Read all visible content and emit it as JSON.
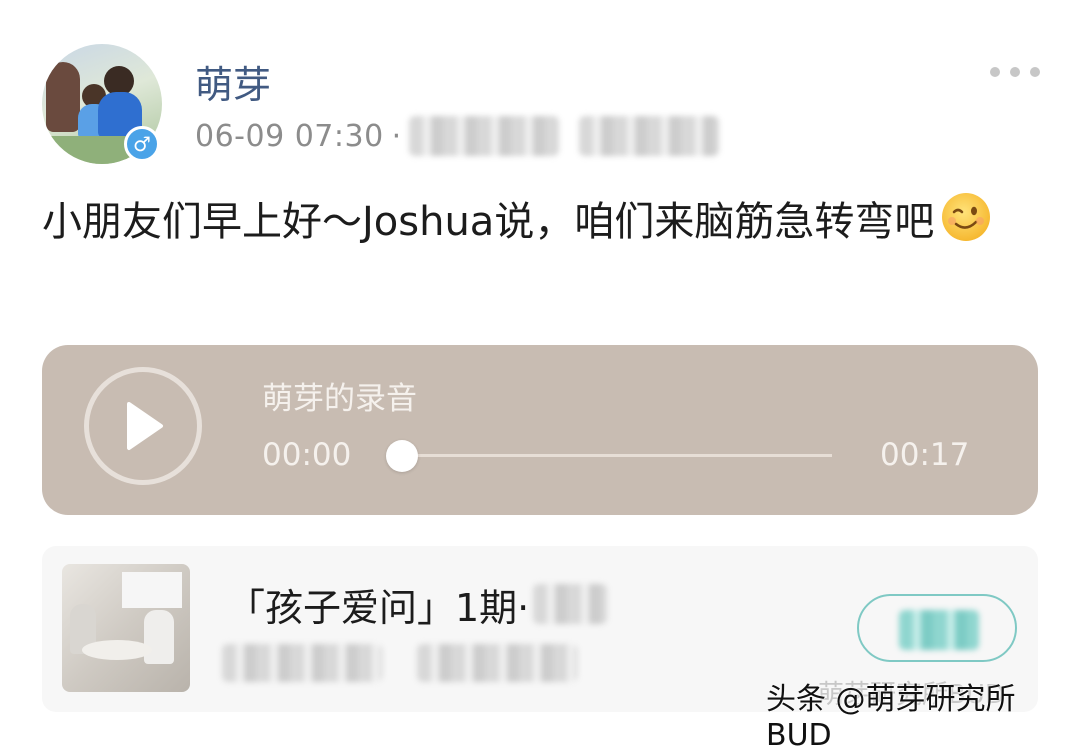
{
  "post": {
    "username": "萌芽",
    "timestamp": "06-09 07:30",
    "separator": "·",
    "gender_symbol": "♂",
    "text": "小朋友们早上好～Joshua说，咱们来脑筋急转弯吧"
  },
  "audio": {
    "title": "萌芽的录音",
    "current_time": "00:00",
    "duration": "00:17",
    "progress": 0
  },
  "link_card": {
    "title": "「孩子爱问」1期·"
  },
  "watermark": {
    "text": "头条 @萌芽研究所BUD",
    "faint_text": "萌芽研究所BUD"
  },
  "icons": {
    "more": "more-dots-icon",
    "play": "play-icon",
    "emoji": "winking-face-icon",
    "gender": "male-icon"
  },
  "colors": {
    "username": "#415a82",
    "audio_card": "#c8bcb2",
    "follow_accent": "#7fc9c4"
  }
}
